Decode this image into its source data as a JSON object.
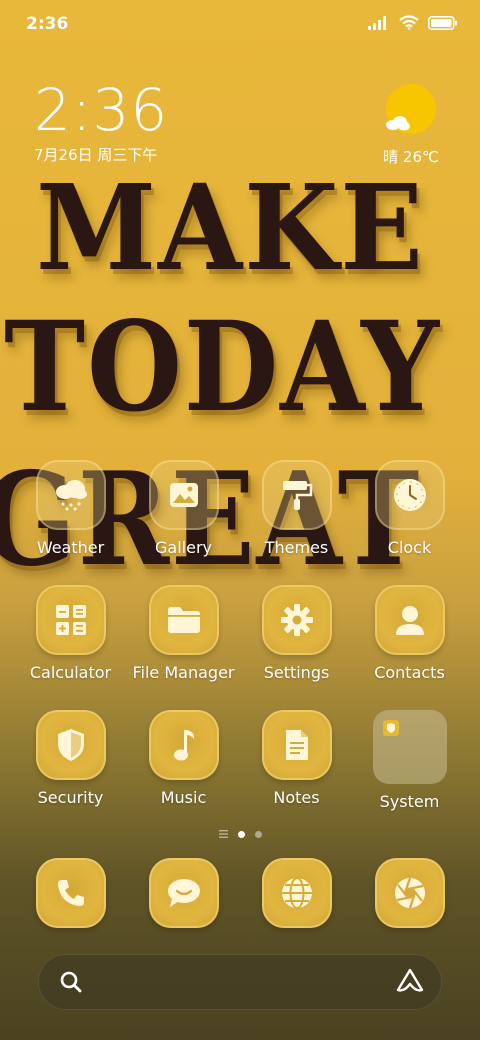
{
  "status_bar": {
    "time": "2:36",
    "icons": [
      "signal-icon",
      "wifi-icon",
      "battery-icon"
    ]
  },
  "clock_widget": {
    "time": "2:36",
    "date": "7月26日 周三下午"
  },
  "weather_widget": {
    "text": "晴 26℃",
    "icon": "sunny-cloud-icon"
  },
  "wallpaper": {
    "lines": [
      "MAKE",
      "TODAY",
      "GREAT"
    ]
  },
  "apps": {
    "row1": [
      {
        "label": "Weather",
        "icon": "weather-icon"
      },
      {
        "label": "Gallery",
        "icon": "gallery-icon"
      },
      {
        "label": "Themes",
        "icon": "themes-icon"
      },
      {
        "label": "Clock",
        "icon": "clock-icon"
      }
    ],
    "row2": [
      {
        "label": "Calculator",
        "icon": "calculator-icon"
      },
      {
        "label": "File Manager",
        "icon": "folder-icon"
      },
      {
        "label": "Settings",
        "icon": "gear-icon"
      },
      {
        "label": "Contacts",
        "icon": "person-icon"
      }
    ],
    "row3": [
      {
        "label": "Security",
        "icon": "shield-icon"
      },
      {
        "label": "Music",
        "icon": "music-note-icon"
      },
      {
        "label": "Notes",
        "icon": "note-icon"
      },
      {
        "label": "System",
        "icon": "folder-icon"
      }
    ]
  },
  "page_indicator": {
    "pages": 2,
    "current": 1
  },
  "dock": [
    {
      "icon": "phone-icon"
    },
    {
      "icon": "message-icon"
    },
    {
      "icon": "browser-icon"
    },
    {
      "icon": "camera-icon"
    }
  ],
  "search_bar": {
    "icons": [
      "search-icon",
      "assistant-icon"
    ]
  },
  "colors": {
    "accent": "#e3b13a",
    "tile": "#d9ad3a",
    "icon": "#fff6d8",
    "text": "#ffffff"
  }
}
